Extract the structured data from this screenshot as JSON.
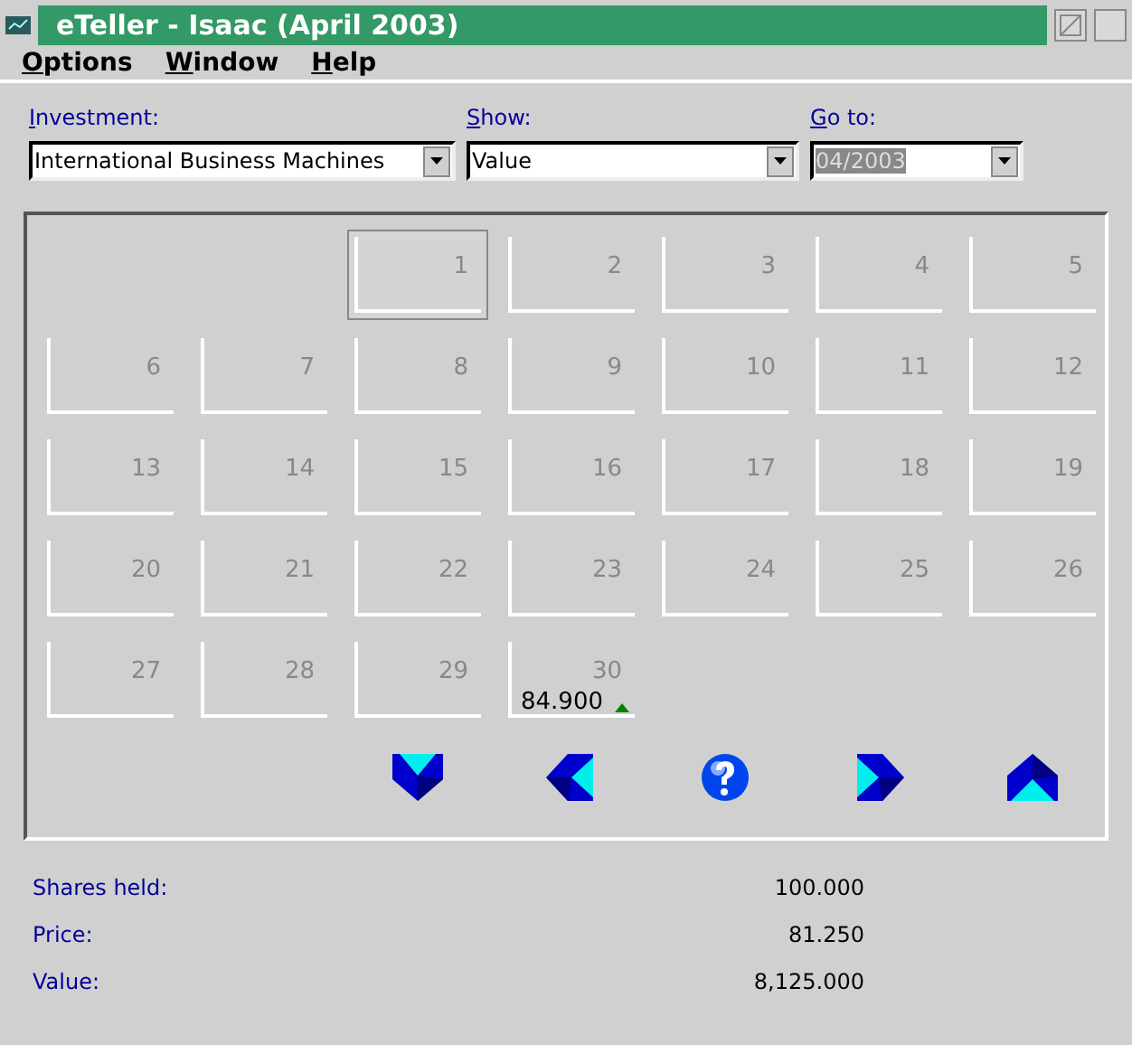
{
  "window": {
    "title": "eTeller - Isaac (April 2003)"
  },
  "menu": [
    {
      "label": "Options"
    },
    {
      "label": "Window"
    },
    {
      "label": "Help"
    }
  ],
  "fields": [
    {
      "label": "Investment:",
      "value": "International Business Machines",
      "highlighted": false
    },
    {
      "label": "Show:",
      "value": "Value",
      "highlighted": false
    },
    {
      "label": "Go to:",
      "value": "04/2003",
      "highlighted": true
    }
  ],
  "weeks": [
    [
      {
        "kind": "blank"
      },
      {
        "kind": "blank"
      },
      {
        "kind": "day",
        "day": "1",
        "selected": true
      },
      {
        "kind": "day",
        "day": "2",
        "selected": false
      },
      {
        "kind": "day",
        "day": "3",
        "selected": false
      },
      {
        "kind": "day",
        "day": "4",
        "selected": false
      },
      {
        "kind": "day",
        "day": "5",
        "selected": false
      }
    ],
    [
      {
        "kind": "day",
        "day": "6",
        "selected": false
      },
      {
        "kind": "day",
        "day": "7",
        "selected": false
      },
      {
        "kind": "day",
        "day": "8",
        "selected": false
      },
      {
        "kind": "day",
        "day": "9",
        "selected": false
      },
      {
        "kind": "day",
        "day": "10",
        "selected": false
      },
      {
        "kind": "day",
        "day": "11",
        "selected": false
      },
      {
        "kind": "day",
        "day": "12",
        "selected": false
      }
    ],
    [
      {
        "kind": "day",
        "day": "13",
        "selected": false
      },
      {
        "kind": "day",
        "day": "14",
        "selected": false
      },
      {
        "kind": "day",
        "day": "15",
        "selected": false
      },
      {
        "kind": "day",
        "day": "16",
        "selected": false
      },
      {
        "kind": "day",
        "day": "17",
        "selected": false
      },
      {
        "kind": "day",
        "day": "18",
        "selected": false
      },
      {
        "kind": "day",
        "day": "19",
        "selected": false
      }
    ],
    [
      {
        "kind": "day",
        "day": "20",
        "selected": false
      },
      {
        "kind": "day",
        "day": "21",
        "selected": false
      },
      {
        "kind": "day",
        "day": "22",
        "selected": false
      },
      {
        "kind": "day",
        "day": "23",
        "selected": false
      },
      {
        "kind": "day",
        "day": "24",
        "selected": false
      },
      {
        "kind": "day",
        "day": "25",
        "selected": false
      },
      {
        "kind": "day",
        "day": "26",
        "selected": false
      }
    ],
    [
      {
        "kind": "day",
        "day": "27",
        "selected": false
      },
      {
        "kind": "day",
        "day": "28",
        "selected": false
      },
      {
        "kind": "day",
        "day": "29",
        "selected": false
      },
      {
        "kind": "day",
        "day": "30",
        "selected": false,
        "value": "84.900",
        "rising": true
      }
    ]
  ],
  "nav": [
    {
      "kind": "down"
    },
    {
      "kind": "left"
    },
    {
      "kind": "help"
    },
    {
      "kind": "right"
    },
    {
      "kind": "up"
    }
  ],
  "summary": [
    {
      "label": "Shares held:",
      "value": "100.000"
    },
    {
      "label": "Price:",
      "value": "81.250"
    },
    {
      "label": "Value:",
      "value": "8,125.000"
    }
  ]
}
